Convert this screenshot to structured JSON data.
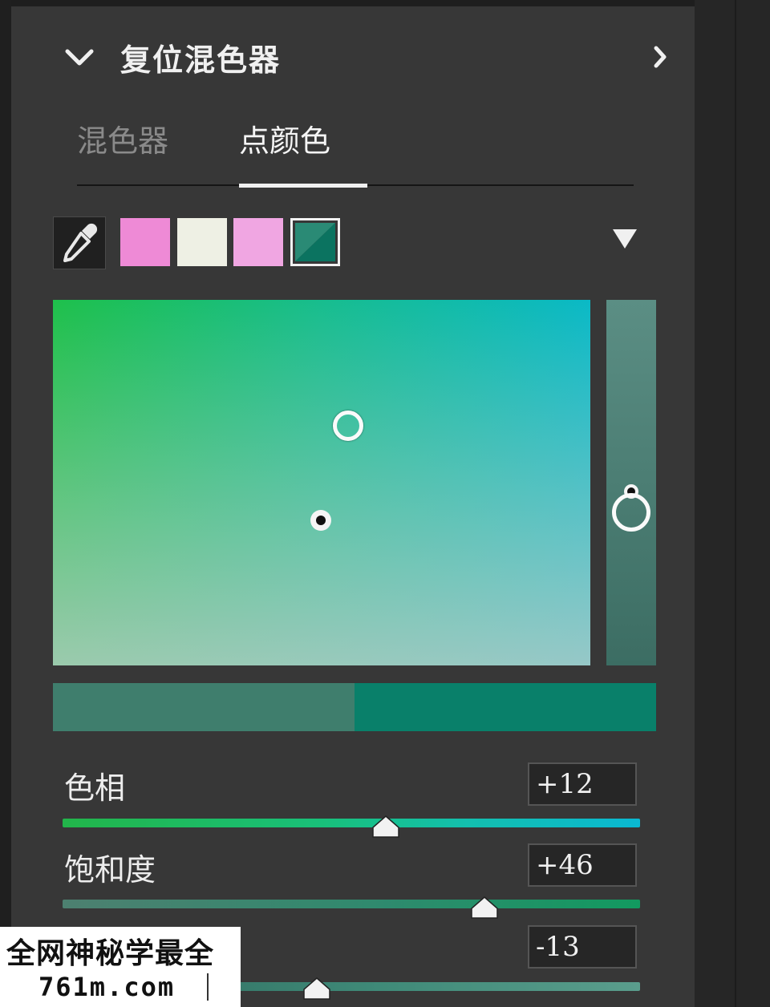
{
  "header": {
    "title": "复位混色器",
    "collapse_icon": "chevron-down-icon",
    "expand_icon": "chevron-right-icon"
  },
  "tabs": [
    {
      "label": "混色器",
      "active": false
    },
    {
      "label": "点颜色",
      "active": true
    }
  ],
  "swatches": [
    {
      "color": "#ee8ad6"
    },
    {
      "color": "#eef0e4"
    },
    {
      "color": "#f0a6e2"
    },
    {
      "color": "#137d68",
      "selected": true
    }
  ],
  "tools": {
    "eyedropper_icon": "eyedropper-icon",
    "dropdown_icon": "triangle-down-icon"
  },
  "compare": {
    "before_color": "#3f7e6d",
    "after_color": "#09806a"
  },
  "sliders": [
    {
      "label": "色相",
      "value": "+12",
      "level": 0.56
    },
    {
      "label": "饱和度",
      "value": "+46",
      "level": 0.73
    },
    {
      "label": "",
      "value": "-13",
      "level": 0.44
    }
  ],
  "watermark": {
    "line1": "全网神秘学最全",
    "line2": "761m.com"
  }
}
